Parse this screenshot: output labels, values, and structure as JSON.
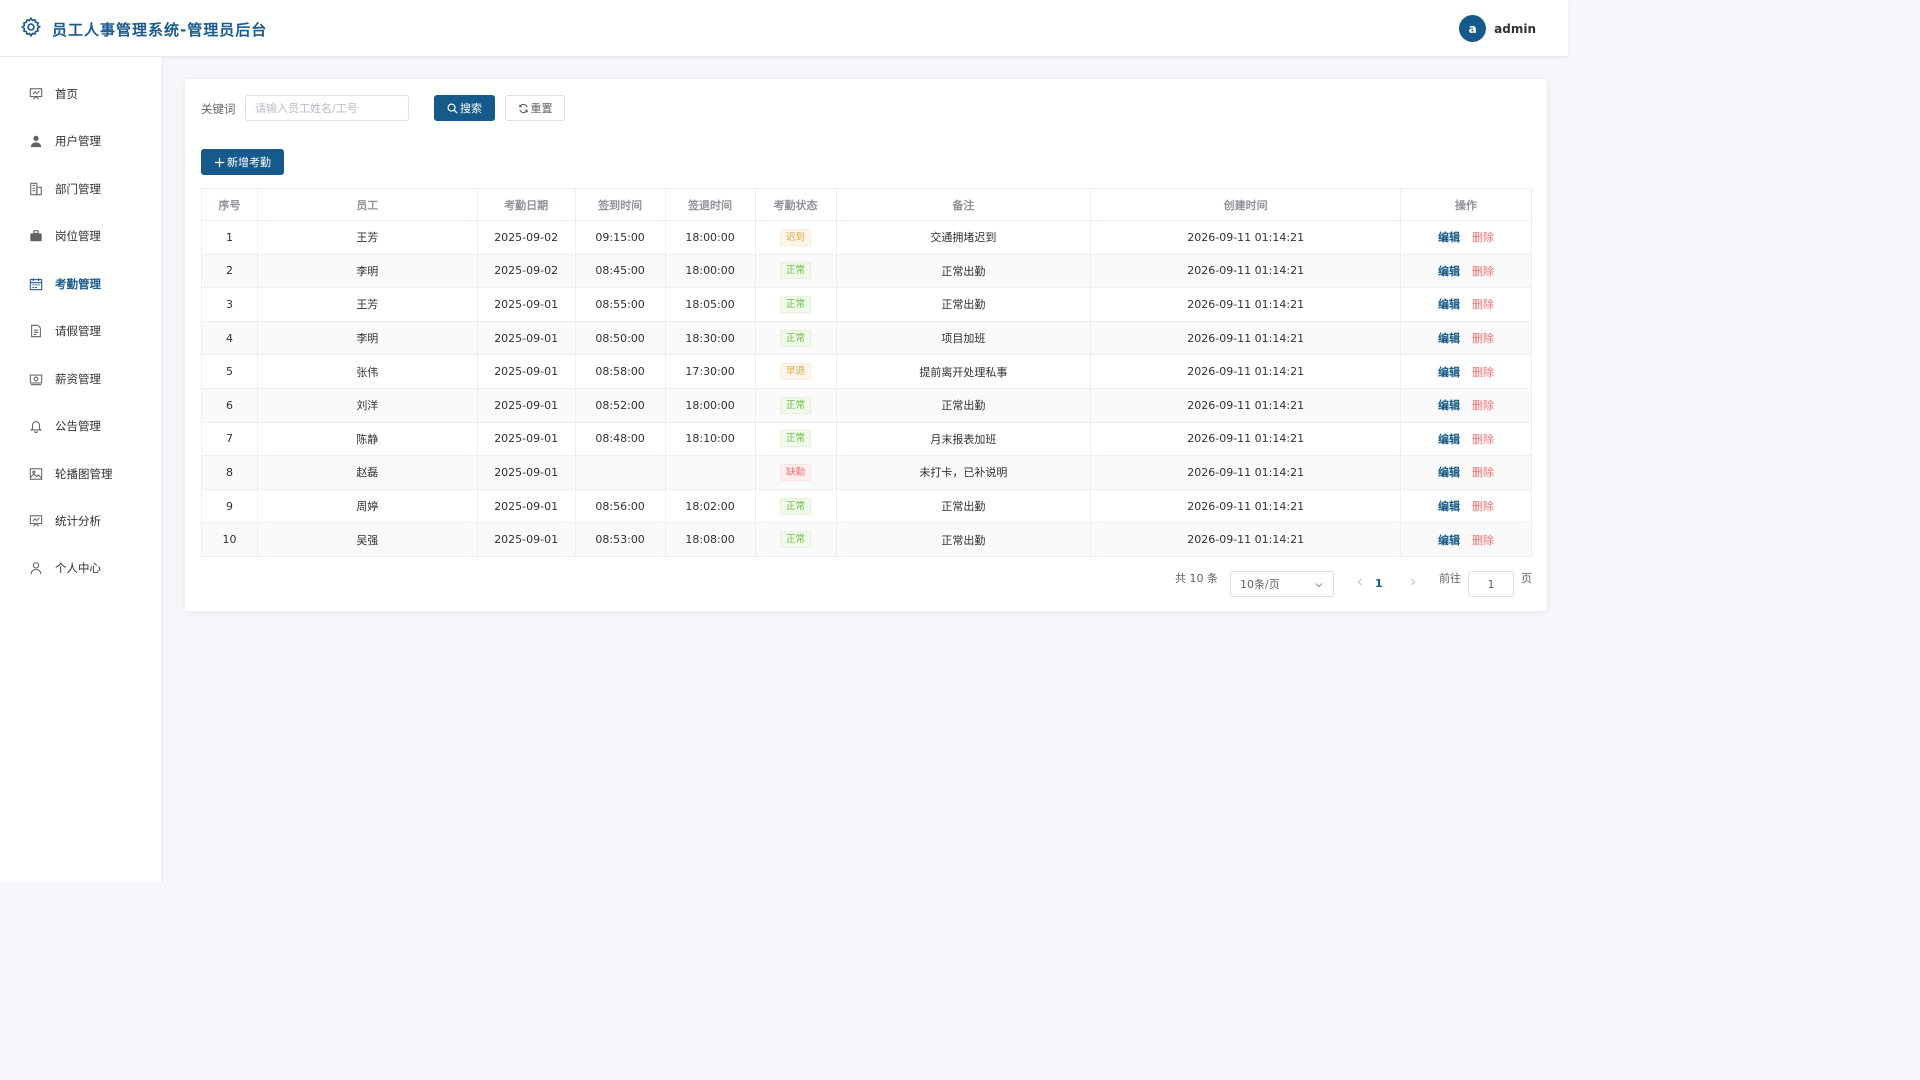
{
  "header": {
    "title": "员工人事管理系统-管理员后台",
    "avatar_letter": "a",
    "username": "admin"
  },
  "sidebar": {
    "items": [
      {
        "label": "首页",
        "icon": "presentation-icon"
      },
      {
        "label": "用户管理",
        "icon": "user-icon"
      },
      {
        "label": "部门管理",
        "icon": "building-icon"
      },
      {
        "label": "岗位管理",
        "icon": "briefcase-icon"
      },
      {
        "label": "考勤管理",
        "icon": "calendar-icon",
        "active": true
      },
      {
        "label": "请假管理",
        "icon": "document-icon"
      },
      {
        "label": "薪资管理",
        "icon": "money-icon"
      },
      {
        "label": "公告管理",
        "icon": "bell-icon"
      },
      {
        "label": "轮播图管理",
        "icon": "picture-icon"
      },
      {
        "label": "统计分析",
        "icon": "presentation-icon"
      },
      {
        "label": "个人中心",
        "icon": "user-outline-icon"
      }
    ]
  },
  "search": {
    "label": "关键词",
    "placeholder": "请输入员工姓名/工号",
    "value": "",
    "search_label": "搜索",
    "reset_label": "重置"
  },
  "toolbar": {
    "add_label": "新增考勤"
  },
  "table": {
    "columns": [
      "序号",
      "员工",
      "考勤日期",
      "签到时间",
      "签退时间",
      "考勤状态",
      "备注",
      "创建时间",
      "操作"
    ],
    "rows": [
      {
        "no": "1",
        "employee": "王芳",
        "date": "2025-09-02",
        "checkin": "09:15:00",
        "checkout": "18:00:00",
        "status": "迟到",
        "status_type": "warn",
        "note": "交通拥堵迟到",
        "created": "2026-09-11 01:14:21"
      },
      {
        "no": "2",
        "employee": "李明",
        "date": "2025-09-02",
        "checkin": "08:45:00",
        "checkout": "18:00:00",
        "status": "正常",
        "status_type": "ok",
        "note": "正常出勤",
        "created": "2026-09-11 01:14:21"
      },
      {
        "no": "3",
        "employee": "王芳",
        "date": "2025-09-01",
        "checkin": "08:55:00",
        "checkout": "18:05:00",
        "status": "正常",
        "status_type": "ok",
        "note": "正常出勤",
        "created": "2026-09-11 01:14:21"
      },
      {
        "no": "4",
        "employee": "李明",
        "date": "2025-09-01",
        "checkin": "08:50:00",
        "checkout": "18:30:00",
        "status": "正常",
        "status_type": "ok",
        "note": "项目加班",
        "created": "2026-09-11 01:14:21"
      },
      {
        "no": "5",
        "employee": "张伟",
        "date": "2025-09-01",
        "checkin": "08:58:00",
        "checkout": "17:30:00",
        "status": "早退",
        "status_type": "warn",
        "note": "提前离开处理私事",
        "created": "2026-09-11 01:14:21"
      },
      {
        "no": "6",
        "employee": "刘洋",
        "date": "2025-09-01",
        "checkin": "08:52:00",
        "checkout": "18:00:00",
        "status": "正常",
        "status_type": "ok",
        "note": "正常出勤",
        "created": "2026-09-11 01:14:21"
      },
      {
        "no": "7",
        "employee": "陈静",
        "date": "2025-09-01",
        "checkin": "08:48:00",
        "checkout": "18:10:00",
        "status": "正常",
        "status_type": "ok",
        "note": "月末报表加班",
        "created": "2026-09-11 01:14:21"
      },
      {
        "no": "8",
        "employee": "赵磊",
        "date": "2025-09-01",
        "checkin": "",
        "checkout": "",
        "status": "缺勤",
        "status_type": "err",
        "note": "未打卡，已补说明",
        "created": "2026-09-11 01:14:21"
      },
      {
        "no": "9",
        "employee": "周婷",
        "date": "2025-09-01",
        "checkin": "08:56:00",
        "checkout": "18:02:00",
        "status": "正常",
        "status_type": "ok",
        "note": "正常出勤",
        "created": "2026-09-11 01:14:21"
      },
      {
        "no": "10",
        "employee": "吴强",
        "date": "2025-09-01",
        "checkin": "08:53:00",
        "checkout": "18:08:00",
        "status": "正常",
        "status_type": "ok",
        "note": "正常出勤",
        "created": "2026-09-11 01:14:21"
      }
    ],
    "edit_label": "编辑",
    "delete_label": "删除"
  },
  "pagination": {
    "total_text": "共 10 条",
    "page_size": "10条/页",
    "current_page": "1",
    "goto_label": "前往",
    "goto_value": "1",
    "page_suffix": "页"
  },
  "colors": {
    "primary": "#155a8a",
    "danger": "#f56c6c",
    "success": "#67c23a",
    "warning": "#e6a23c"
  }
}
